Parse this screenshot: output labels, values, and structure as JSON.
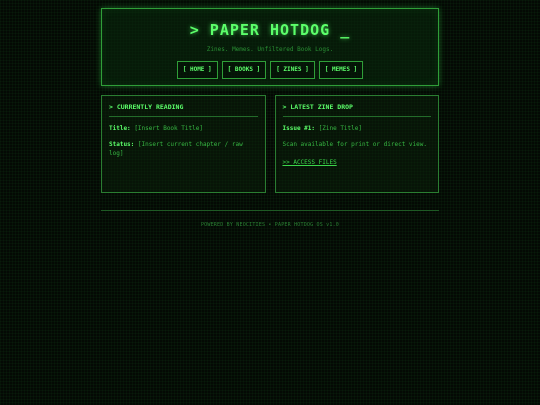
{
  "header": {
    "title": "> PAPER HOTDOG _",
    "tagline": "Zines. Memes. Unfiltered Book Logs."
  },
  "nav": [
    {
      "label": "HOME"
    },
    {
      "label": "BOOKS"
    },
    {
      "label": "ZINES"
    },
    {
      "label": "MEMES"
    }
  ],
  "reading": {
    "heading": "> CURRENTLY READING",
    "title_label": "Title:",
    "title_value": "[Insert Book Title]",
    "status_label": "Status:",
    "status_value": "[Insert current chapter / raw log]"
  },
  "zine": {
    "heading": "> LATEST ZINE DROP",
    "issue_label": "Issue #1:",
    "issue_value": "[Zine Title]",
    "description": "Scan available for print or direct view.",
    "link": ">> ACCESS_FILES"
  },
  "footer": {
    "text": "POWERED BY NEOCITIES • PAPER HOTDOG OS v1.0"
  },
  "colors": {
    "background": "#040904",
    "accent": "#5cff6a",
    "border": "#2f9e38"
  }
}
